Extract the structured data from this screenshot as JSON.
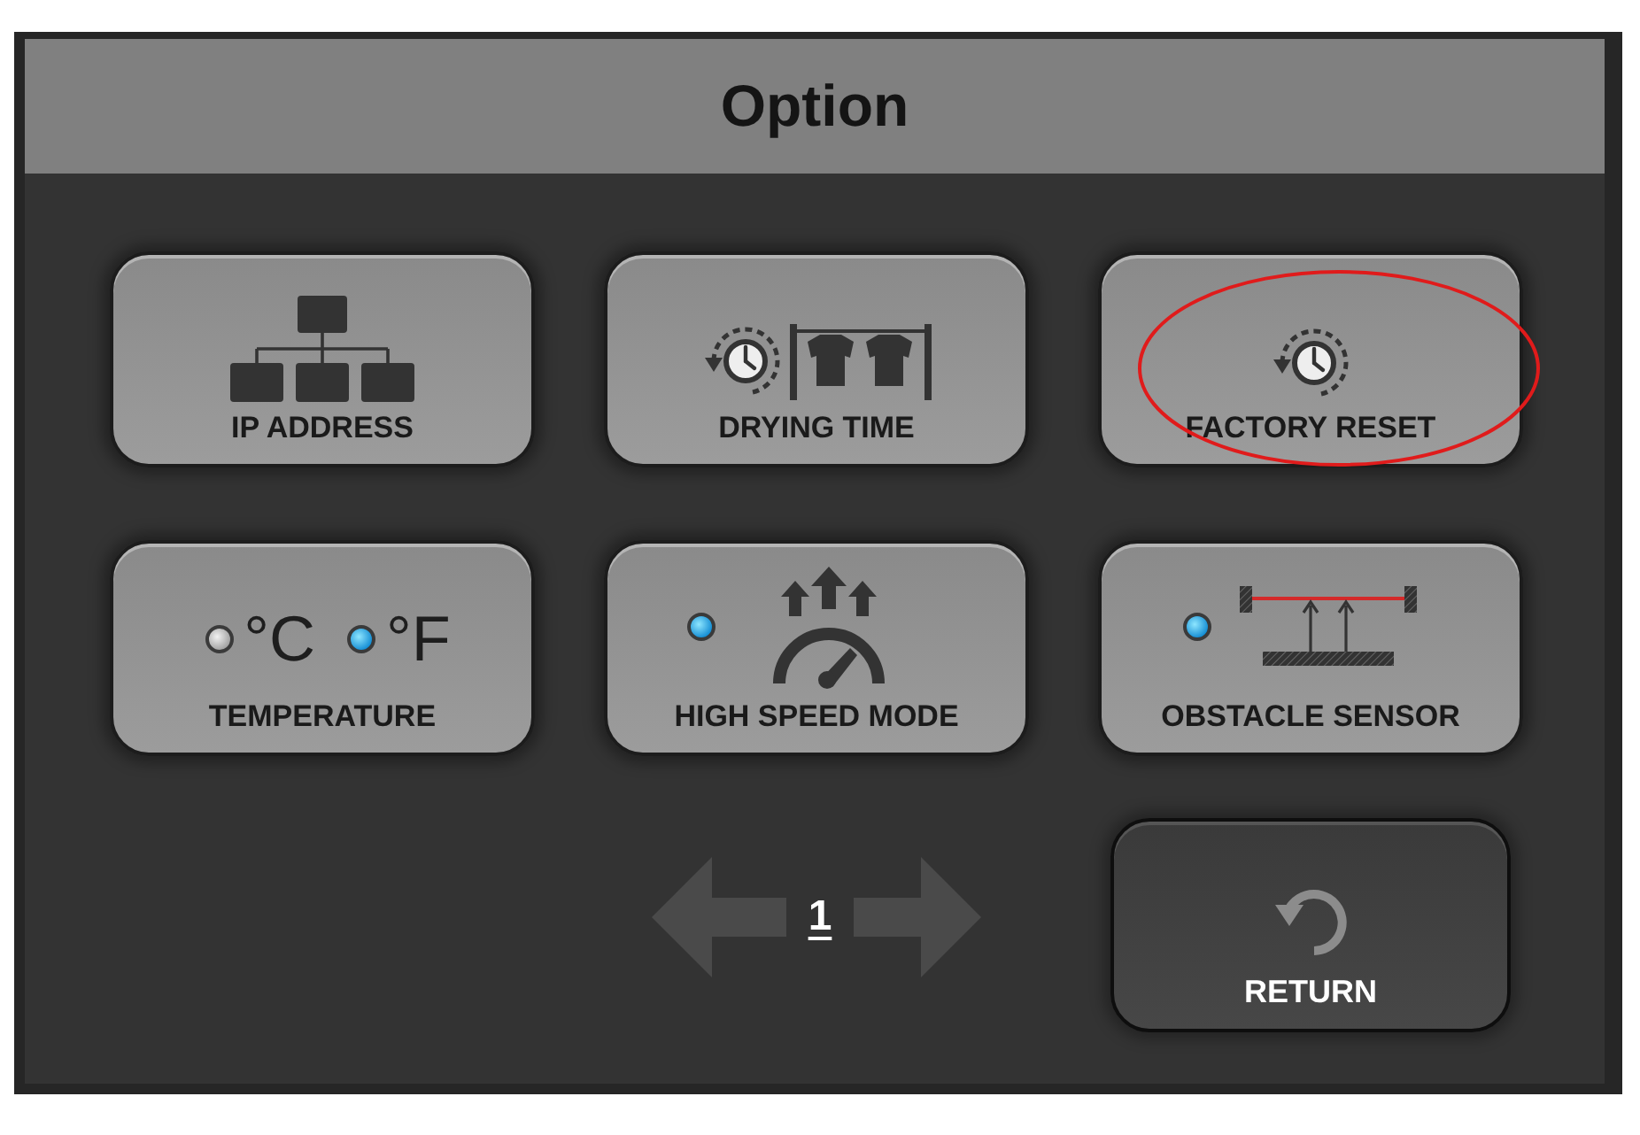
{
  "dialog": {
    "title": "Option"
  },
  "buttons": [
    {
      "kind": "ip",
      "label": "IP ADDRESS",
      "highlighted": false
    },
    {
      "kind": "drying",
      "label": "DRYING TIME",
      "highlighted": false
    },
    {
      "kind": "reset",
      "label": "FACTORY RESET",
      "highlighted": true
    },
    {
      "kind": "temperature",
      "label": "TEMPERATURE",
      "highlighted": false,
      "units": [
        {
          "symbol": "°C",
          "selected": false
        },
        {
          "symbol": "°F",
          "selected": true
        }
      ]
    },
    {
      "kind": "speed",
      "label": "HIGH SPEED MODE",
      "highlighted": false,
      "on": true
    },
    {
      "kind": "sensor",
      "label": "OBSTACLE SENSOR",
      "highlighted": false,
      "on": true
    }
  ],
  "pager": {
    "page": "1"
  },
  "return_button": {
    "label": "RETURN"
  }
}
